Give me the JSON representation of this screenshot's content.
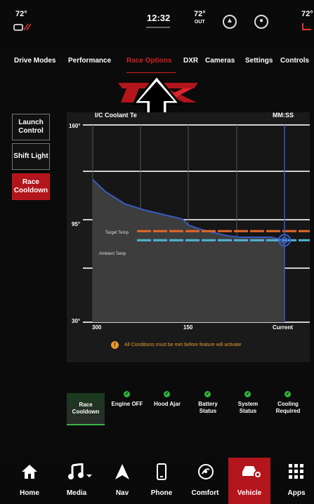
{
  "topbar": {
    "left_temp": "72°",
    "time": "12:32",
    "outside_temp": "72°",
    "outside_label": "OUT",
    "right_temp": "72°"
  },
  "tabs": [
    {
      "label": "Drive Modes"
    },
    {
      "label": "Performance"
    },
    {
      "label": "Race Options"
    },
    {
      "label": "DXR"
    },
    {
      "label": "Cameras"
    },
    {
      "label": "Settings"
    },
    {
      "label": "Controls"
    }
  ],
  "logo_text": "TRX",
  "side_buttons": [
    {
      "label": "Launch Control"
    },
    {
      "label": "Shift Light"
    },
    {
      "label": "Race Cooldown"
    }
  ],
  "chart": {
    "title": "I/C Coolant Te",
    "time_unit": "MM:SS",
    "y_ticks": [
      "160°",
      "95°",
      "30°"
    ],
    "x_ticks": [
      "300",
      "150",
      "Current"
    ],
    "target_label": "Target Temp",
    "ambient_label": "Ambient Temp",
    "warning": "All Conditions must be met before feature will activate",
    "warning_icon": "!"
  },
  "chart_data": {
    "type": "line",
    "x_reversed": true,
    "xlim": [
      300,
      0
    ],
    "ylim": [
      30,
      160
    ],
    "series": [
      {
        "x": [
          300,
          280,
          250,
          220,
          200,
          160,
          150,
          130,
          110,
          90,
          70,
          50,
          20,
          0
        ],
        "y": [
          124,
          116,
          108,
          104,
          102,
          98,
          94,
          91,
          89,
          87,
          86,
          86,
          86,
          84
        ]
      }
    ],
    "target_temp": 90,
    "ambient_temp": 84,
    "colors": {
      "line": "#3a5bbf",
      "target": "#e0692a",
      "ambient": "#4fb6d6",
      "fill": "#3d3d3d"
    }
  },
  "conditions": [
    {
      "label": "Race Cooldown",
      "checked": false
    },
    {
      "label": "Engine OFF",
      "checked": true
    },
    {
      "label": "Hood Ajar",
      "checked": true
    },
    {
      "label": "Battery Status",
      "checked": true
    },
    {
      "label": "System Status",
      "checked": true
    },
    {
      "label": "Cooling Required",
      "checked": true
    }
  ],
  "bottom_nav": [
    {
      "label": "Home",
      "icon": "home-icon"
    },
    {
      "label": "Media",
      "icon": "music-note-icon"
    },
    {
      "label": "Nav",
      "icon": "navigation-arrow-icon"
    },
    {
      "label": "Phone",
      "icon": "phone-icon"
    },
    {
      "label": "Comfort",
      "icon": "comfort-icon"
    },
    {
      "label": "Vehicle",
      "icon": "vehicle-icon"
    },
    {
      "label": "Apps",
      "icon": "apps-grid-icon"
    }
  ],
  "accent_color": "#b3151c"
}
